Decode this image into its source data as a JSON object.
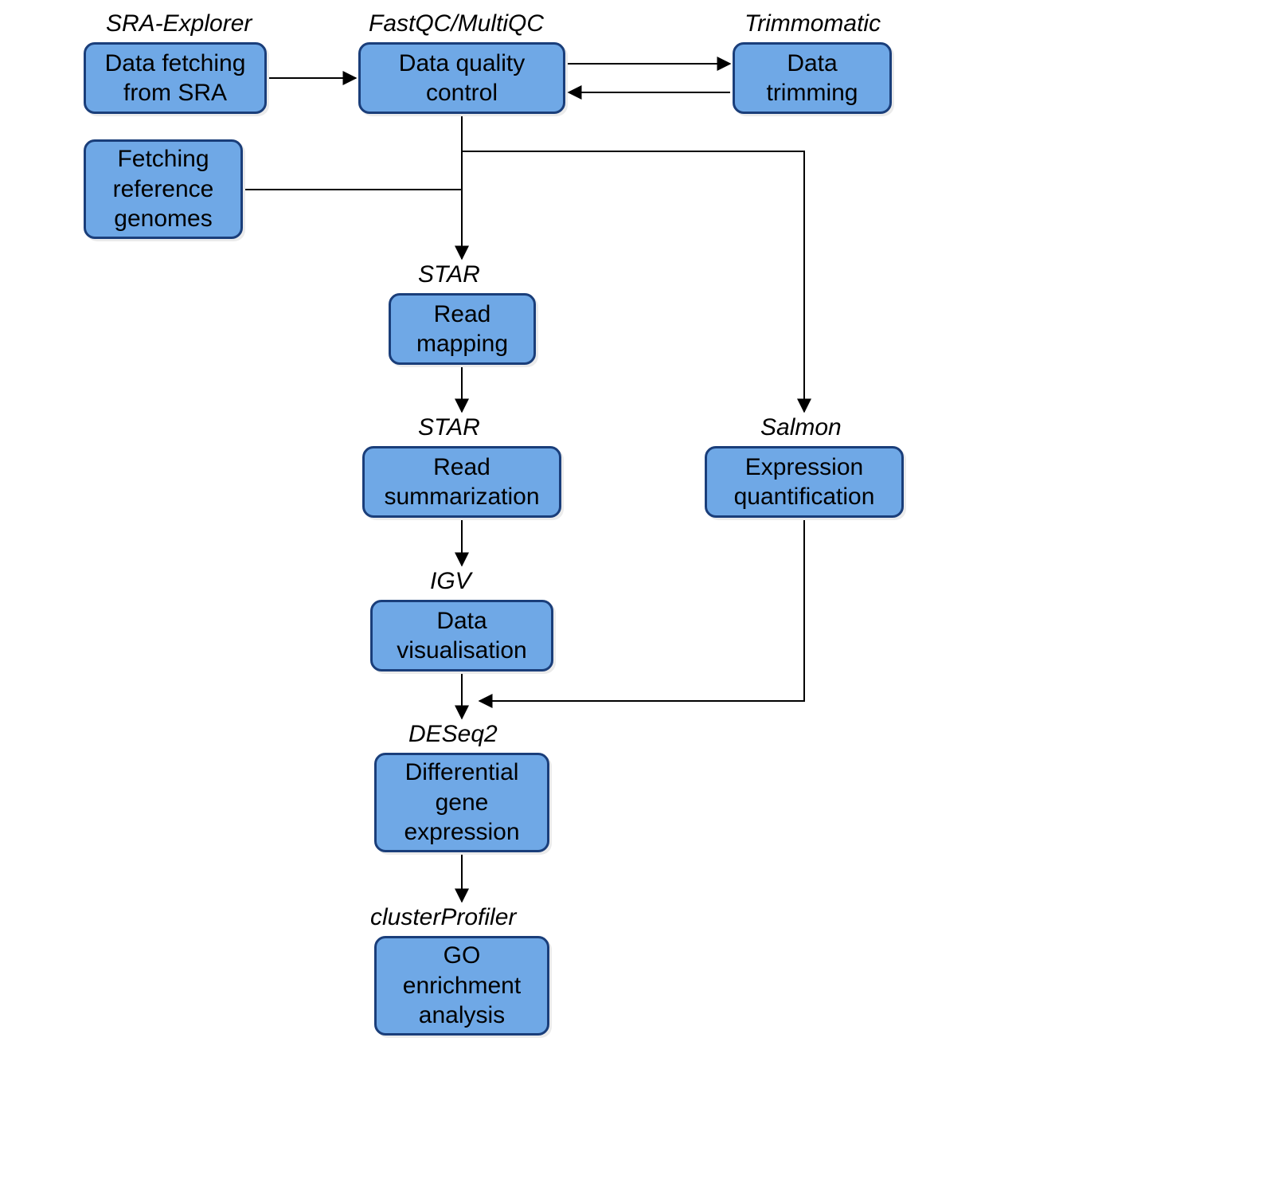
{
  "tools": {
    "sra_explorer": "SRA-Explorer",
    "fastqc_multiqc": "FastQC/MultiQC",
    "trimmomatic": "Trimmomatic",
    "star_map": "STAR",
    "star_sum": "STAR",
    "salmon": "Salmon",
    "igv": "IGV",
    "deseq2": "DESeq2",
    "clusterprofiler": "clusterProfiler"
  },
  "nodes": {
    "data_fetching": "Data fetching from SRA",
    "data_qc": "Data quality control",
    "data_trimming": "Data trimming",
    "fetch_ref": "Fetching reference genomes",
    "read_mapping": "Read mapping",
    "read_summ": "Read summarization",
    "expr_quant": "Expression quantification",
    "data_vis": "Data visualisation",
    "diff_expr": "Differential gene expression",
    "go_enrich": "GO enrichment analysis"
  },
  "colors": {
    "node_fill": "#6fa8e6",
    "node_border": "#1a3e7a",
    "arrow": "#000000"
  }
}
